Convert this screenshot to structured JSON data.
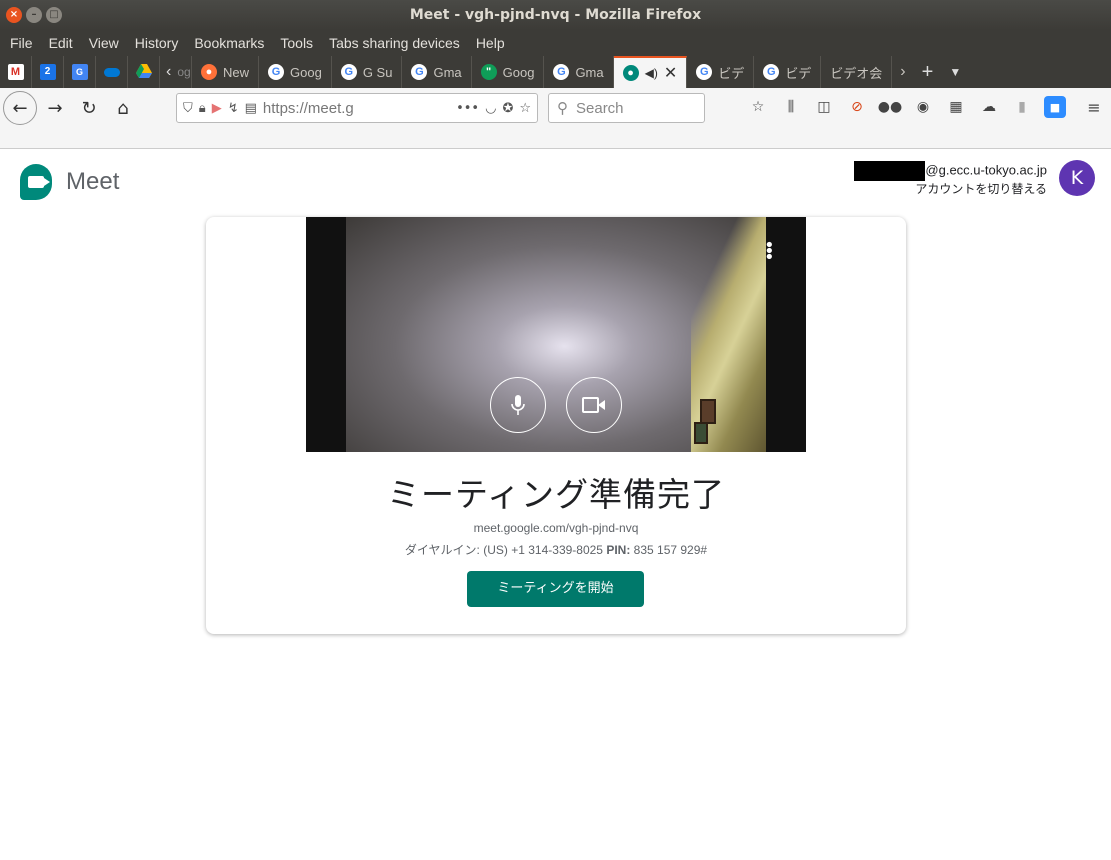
{
  "window": {
    "title": "Meet - vgh-pjnd-nvq - Mozilla Firefox"
  },
  "menu": [
    "File",
    "Edit",
    "View",
    "History",
    "Bookmarks",
    "Tools",
    "Tabs sharing devices",
    "Help"
  ],
  "tabs": [
    {
      "label": "og",
      "icon": "google-icon"
    },
    {
      "label": "New",
      "icon": "firefox-icon"
    },
    {
      "label": "Goog",
      "icon": "google-icon"
    },
    {
      "label": "G Su",
      "icon": "google-icon"
    },
    {
      "label": "Gma",
      "icon": "google-icon"
    },
    {
      "label": "Goog",
      "icon": "hangouts-icon"
    },
    {
      "label": "Gma",
      "icon": "google-icon"
    },
    {
      "label": "",
      "icon": "meet-icon",
      "active": true
    },
    {
      "label": "ビデ",
      "icon": "google-icon"
    },
    {
      "label": "ビデ",
      "icon": "google-icon"
    },
    {
      "label": "ビデオ会",
      "icon": ""
    }
  ],
  "pinned": [
    "gmail-icon",
    "calendar-icon",
    "translate-icon",
    "onedrive-icon",
    "drive-icon"
  ],
  "calendar_day": "2",
  "url": "https://meet.g",
  "search_placeholder": "Search",
  "app": {
    "name": "Meet"
  },
  "account": {
    "email": "@g.ecc.u-tokyo.ac.jp",
    "switch_label": "アカウントを切り替える",
    "avatar_letter": "K"
  },
  "meeting": {
    "title": "ミーティング準備完了",
    "link": "meet.google.com/vgh-pjnd-nvq",
    "dial_label": "ダイヤルイン:",
    "dial_number": "(US) +1 314-339-8025",
    "pin_label": "PIN:",
    "pin": "835 157 929#",
    "start_button": "ミーティングを開始"
  },
  "colors": {
    "accent": "#00796b",
    "avatar": "#5e35b1",
    "ubuntu": "#e95420"
  }
}
